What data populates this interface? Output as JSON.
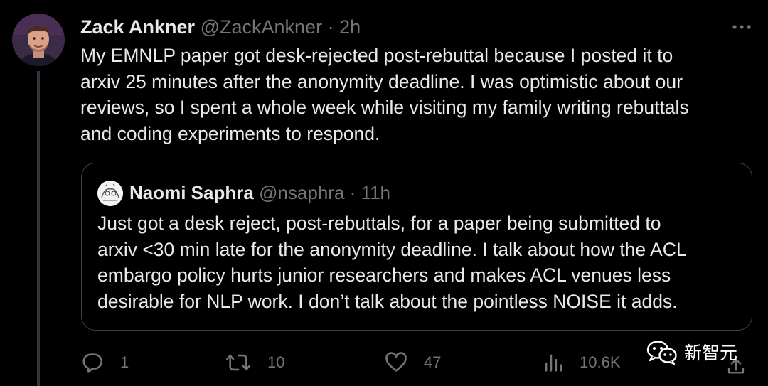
{
  "tweet": {
    "author": {
      "display_name": "Zack Ankner",
      "handle": "@ZackAnkner",
      "separator": "·",
      "time": "2h"
    },
    "text_lines": [
      "My EMNLP paper got desk-rejected post-rebuttal because I posted it to",
      "arxiv 25 minutes after the anonymity deadline. I was optimistic about our",
      "reviews, so I spent a whole week while visiting my family writing rebuttals",
      "and coding experiments to respond."
    ],
    "more_icon": "more-horizontal-icon"
  },
  "quote": {
    "author": {
      "display_name": "Naomi Saphra",
      "handle": "@nsaphra",
      "separator": "·",
      "time": "11h"
    },
    "text_lines": [
      "Just got a desk reject, post-rebuttals, for a paper being submitted to",
      "arxiv <30 min late for the anonymity deadline. I talk about how the ACL",
      "embargo policy hurts junior researchers and makes ACL venues less",
      "desirable for NLP work. I don’t talk about the pointless NOISE it adds."
    ]
  },
  "actions": {
    "reply": {
      "icon": "reply-icon",
      "count": "1"
    },
    "retweet": {
      "icon": "retweet-icon",
      "count": "10"
    },
    "like": {
      "icon": "heart-icon",
      "count": "47"
    },
    "views": {
      "icon": "views-icon",
      "count": "10.6K"
    },
    "share": {
      "icon": "share-icon"
    }
  },
  "watermark": {
    "icon": "wechat-icon",
    "text": "新智元"
  },
  "colors": {
    "background": "#000000",
    "text_primary": "#e7e9ea",
    "text_secondary": "#71767b",
    "border": "#3e4144"
  }
}
